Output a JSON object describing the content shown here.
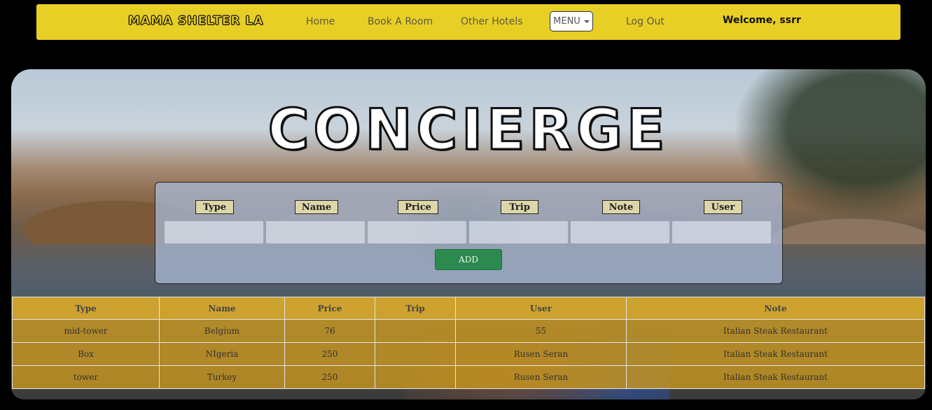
{
  "nav": {
    "brand": "MAMA SHELTER LA",
    "links": [
      "Home",
      "Book A Room",
      "Other Hotels"
    ],
    "menu_label": "MENU",
    "logout": "Log Out",
    "welcome": "Welcome, ssrr"
  },
  "hero": {
    "title": "CONCIERGE"
  },
  "form": {
    "fields": [
      "Type",
      "Name",
      "Price",
      "Trip",
      "Note",
      "User"
    ],
    "add_label": "ADD"
  },
  "table": {
    "headers": [
      "Type",
      "Name",
      "Price",
      "Trip",
      "User",
      "Note"
    ],
    "rows": [
      [
        "mid-tower",
        "Belgium",
        "76",
        "",
        "55",
        "Italian Steak Restaurant"
      ],
      [
        "Box",
        "NIgeria",
        "250",
        "",
        "Rusen Seran",
        "Italian Steak Restaurant"
      ],
      [
        "tower",
        "Turkey",
        "250",
        "",
        "Rusen Seran",
        "Italian Steak Restaurant"
      ]
    ]
  },
  "colors": {
    "navbar_bg": "#e8cf25",
    "add_button": "#2c8a4e",
    "table_row": "#c8961e"
  }
}
